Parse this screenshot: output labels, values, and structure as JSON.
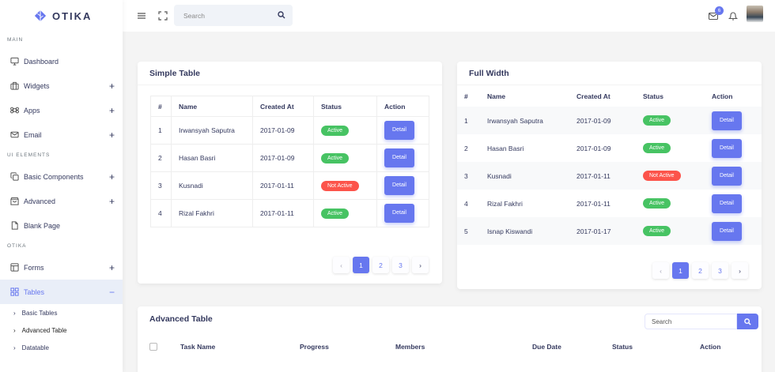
{
  "brand": {
    "name": "OTIKA"
  },
  "sidebar": {
    "sections": [
      {
        "header": "MAIN"
      },
      {
        "header": "UI ELEMENTS"
      },
      {
        "header": "OTIKA"
      }
    ],
    "items": [
      {
        "label": "Dashboard",
        "icon": "monitor-icon"
      },
      {
        "label": "Widgets",
        "icon": "briefcase-icon",
        "expand": "+"
      },
      {
        "label": "Apps",
        "icon": "command-icon",
        "expand": "+"
      },
      {
        "label": "Email",
        "icon": "mail-icon",
        "expand": "+"
      },
      {
        "label": "Basic Components",
        "icon": "copy-icon",
        "expand": "+"
      },
      {
        "label": "Advanced",
        "icon": "shopping-bag-icon",
        "expand": "+"
      },
      {
        "label": "Blank Page",
        "icon": "file-icon"
      },
      {
        "label": "Forms",
        "icon": "layout-icon",
        "expand": "+"
      },
      {
        "label": "Tables",
        "icon": "grid-icon",
        "expand": "−"
      }
    ],
    "subitems": [
      {
        "label": "Basic Tables"
      },
      {
        "label": "Advanced Table"
      },
      {
        "label": "Datatable"
      }
    ]
  },
  "navbar": {
    "search_placeholder": "Search",
    "mail_badge": "6"
  },
  "simple_table": {
    "title": "Simple Table",
    "columns": [
      "#",
      "Name",
      "Created At",
      "Status",
      "Action"
    ],
    "rows": [
      {
        "num": "1",
        "name": "Irwansyah Saputra",
        "created": "2017-01-09",
        "status": "Active",
        "action": "Detail"
      },
      {
        "num": "2",
        "name": "Hasan Basri",
        "created": "2017-01-09",
        "status": "Active",
        "action": "Detail"
      },
      {
        "num": "3",
        "name": "Kusnadi",
        "created": "2017-01-11",
        "status": "Not Active",
        "action": "Detail"
      },
      {
        "num": "4",
        "name": "Rizal Fakhri",
        "created": "2017-01-11",
        "status": "Active",
        "action": "Detail"
      }
    ],
    "pages": [
      "1",
      "2",
      "3"
    ]
  },
  "full_width": {
    "title": "Full Width",
    "columns": [
      "#",
      "Name",
      "Created At",
      "Status",
      "Action"
    ],
    "rows": [
      {
        "num": "1",
        "name": "Irwansyah Saputra",
        "created": "2017-01-09",
        "status": "Active",
        "action": "Detail"
      },
      {
        "num": "2",
        "name": "Hasan Basri",
        "created": "2017-01-09",
        "status": "Active",
        "action": "Detail"
      },
      {
        "num": "3",
        "name": "Kusnadi",
        "created": "2017-01-11",
        "status": "Not Active",
        "action": "Detail"
      },
      {
        "num": "4",
        "name": "Rizal Fakhri",
        "created": "2017-01-11",
        "status": "Active",
        "action": "Detail"
      },
      {
        "num": "5",
        "name": "Isnap Kiswandi",
        "created": "2017-01-17",
        "status": "Active",
        "action": "Detail"
      }
    ],
    "pages": [
      "1",
      "2",
      "3"
    ]
  },
  "advanced_table": {
    "title": "Advanced Table",
    "search_placeholder": "Search",
    "columns": [
      "Task Name",
      "Progress",
      "Members",
      "Due Date",
      "Status",
      "Action"
    ]
  },
  "colors": {
    "accent": "#6777ef",
    "success": "#47c363",
    "danger": "#fc544b",
    "active_bg": "#e9eef8"
  }
}
